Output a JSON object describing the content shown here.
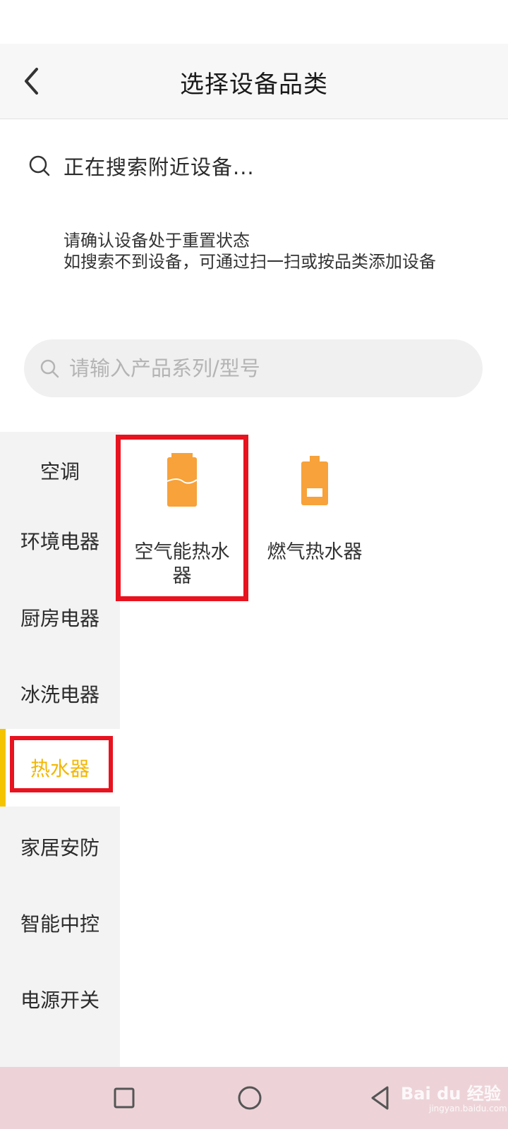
{
  "header": {
    "title": "选择设备品类"
  },
  "scan": {
    "status_text": "正在搜索附近设备..."
  },
  "hint": {
    "line1": "请确认设备处于重置状态",
    "line2": "如搜索不到设备，可通过扫一扫或按品类添加设备"
  },
  "search": {
    "placeholder": "请输入产品系列/型号",
    "value": ""
  },
  "sidebar": {
    "items": [
      {
        "label": "空调"
      },
      {
        "label": "环境电器"
      },
      {
        "label": "厨房电器"
      },
      {
        "label": "冰洗电器"
      },
      {
        "label": "热水器",
        "selected": true
      },
      {
        "label": "家居安防"
      },
      {
        "label": "智能中控"
      },
      {
        "label": "电源开关"
      }
    ]
  },
  "products": [
    {
      "label_line1": "空气能热水",
      "label_line2": "器",
      "icon": "air-water-heater-icon",
      "highlighted": true
    },
    {
      "label_line1": "燃气热水器",
      "label_line2": "",
      "icon": "gas-water-heater-icon",
      "highlighted": false
    }
  ],
  "nav": {
    "icons": [
      "recent-apps-icon",
      "home-icon",
      "back-icon"
    ]
  },
  "watermark": {
    "main": "Bai du 经验",
    "sub": "jingyan.baidu.com"
  },
  "colors": {
    "accent": "#f4c400",
    "selected_text": "#f2b705",
    "highlight_box": "#e8131f",
    "product_orange": "#f7a23a"
  }
}
